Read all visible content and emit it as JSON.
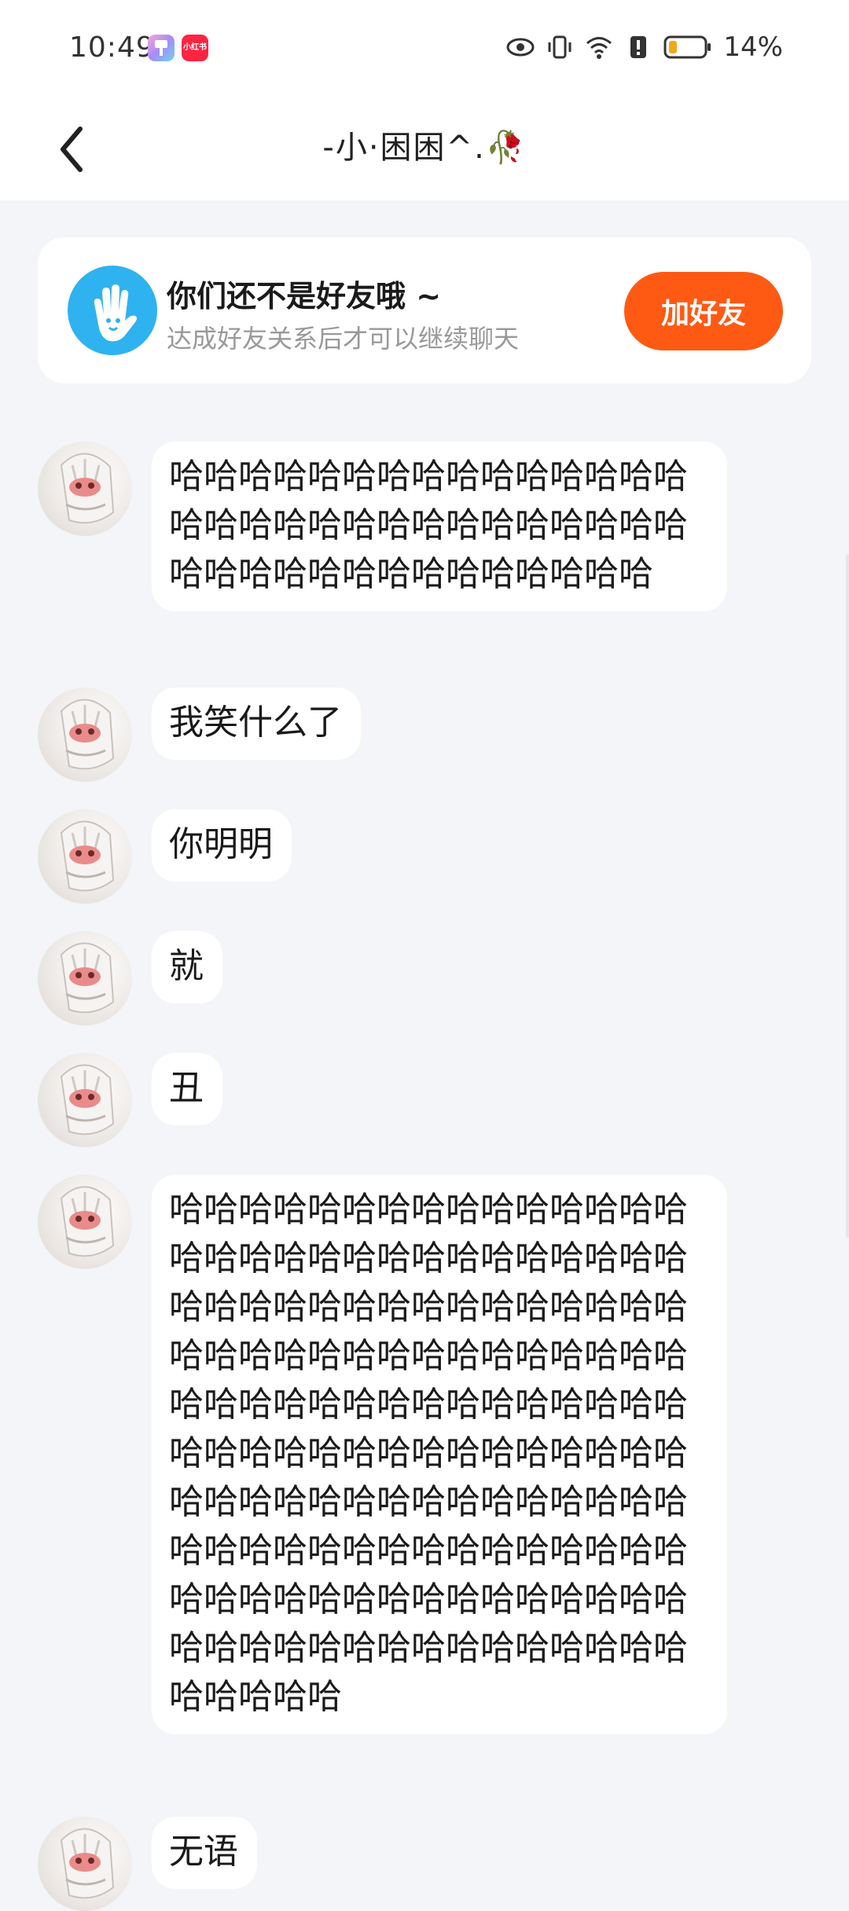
{
  "status_bar": {
    "time": "10:49",
    "app_icon_2_text": "小红书",
    "battery": "14%"
  },
  "header": {
    "title": "-小·困困^.🥀"
  },
  "friend_card": {
    "title": "你们还不是好友哦 ~",
    "subtitle": "达成好友关系后才可以继续聊天",
    "button": "加好友"
  },
  "messages": [
    {
      "text": "哈哈哈哈哈哈哈哈哈哈哈哈哈哈哈哈哈哈哈哈哈哈哈哈哈哈哈哈哈哈哈哈哈哈哈哈哈哈哈哈哈哈哈哈"
    },
    {
      "text": "我笑什么了"
    },
    {
      "text": "你明明"
    },
    {
      "text": "就"
    },
    {
      "text": "丑"
    },
    {
      "text": "哈哈哈哈哈哈哈哈哈哈哈哈哈哈哈哈哈哈哈哈哈哈哈哈哈哈哈哈哈哈哈哈哈哈哈哈哈哈哈哈哈哈哈哈哈哈哈哈哈哈哈哈哈哈哈哈哈哈哈哈哈哈哈哈哈哈哈哈哈哈哈哈哈哈哈哈哈哈哈哈哈哈哈哈哈哈哈哈哈哈哈哈哈哈哈哈哈哈哈哈哈哈哈哈哈哈哈哈哈哈哈哈哈哈哈哈哈哈哈哈哈哈哈哈哈哈哈哈哈哈哈哈哈哈哈哈哈哈哈哈哈哈哈哈哈哈哈哈哈哈哈哈哈哈哈"
    },
    {
      "text": "无语"
    }
  ],
  "colors": {
    "accent": "#ff5a14",
    "background": "#f3f5f8",
    "icon_blue": "#2fb2f0"
  }
}
